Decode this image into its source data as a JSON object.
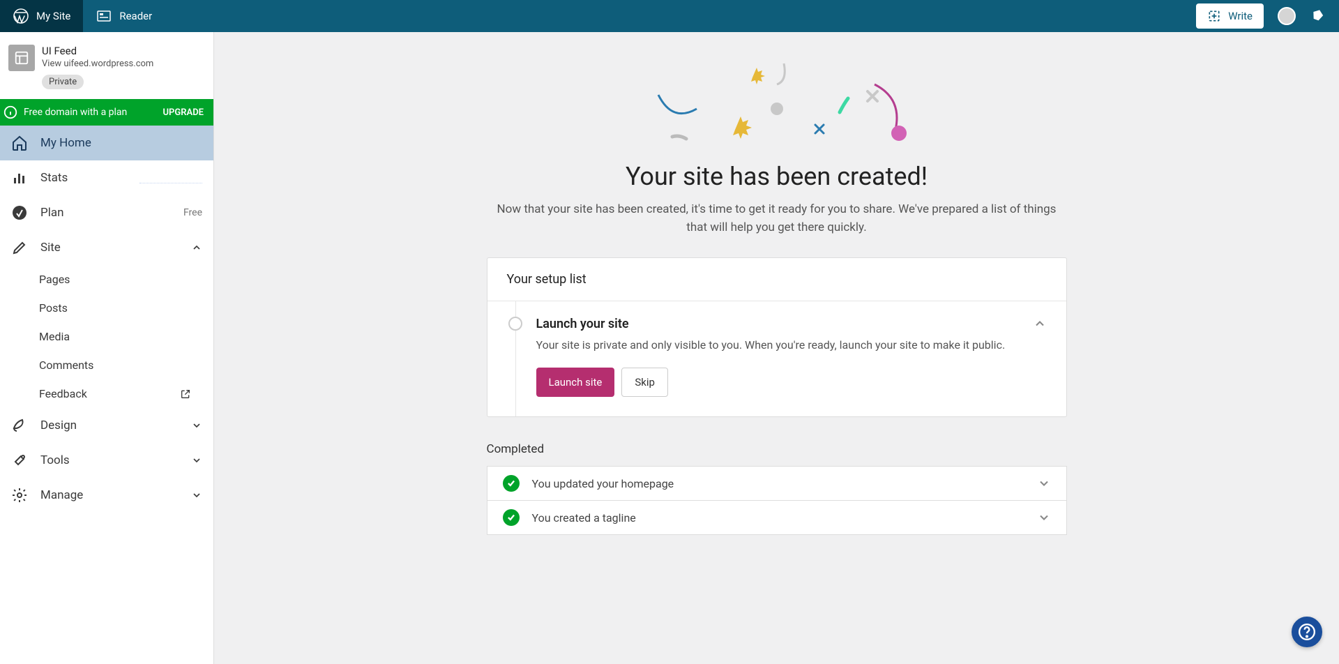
{
  "topbar": {
    "my_site": "My Site",
    "reader": "Reader",
    "write": "Write"
  },
  "site": {
    "name": "UI Feed",
    "url_label": "View uifeed.wordpress.com",
    "badge": "Private"
  },
  "upgrade": {
    "text": "Free domain with a plan",
    "cta": "UPGRADE"
  },
  "nav": {
    "my_home": "My Home",
    "stats": "Stats",
    "plan": "Plan",
    "plan_trailing": "Free",
    "site": "Site",
    "site_children": {
      "pages": "Pages",
      "posts": "Posts",
      "media": "Media",
      "comments": "Comments",
      "feedback": "Feedback"
    },
    "design": "Design",
    "tools": "Tools",
    "manage": "Manage"
  },
  "hero": {
    "title": "Your site has been created!",
    "subtitle": "Now that your site has been created, it's time to get it ready for you to share. We've prepared a list of things that will help you get there quickly."
  },
  "setup": {
    "header": "Your setup list",
    "task_title": "Launch your site",
    "task_desc": "Your site is private and only visible to you. When you're ready, launch your site to make it public.",
    "launch_btn": "Launch site",
    "skip_btn": "Skip"
  },
  "completed": {
    "heading": "Completed",
    "items": [
      "You updated your homepage",
      "You created a tagline"
    ]
  }
}
